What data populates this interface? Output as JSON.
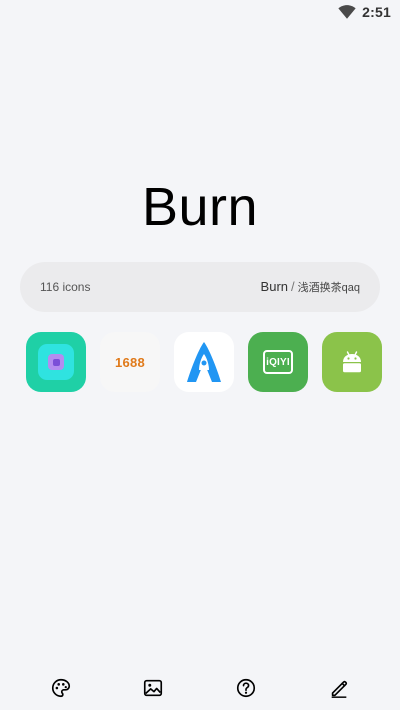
{
  "status_bar": {
    "time": "2:51",
    "wifi_icon": "wifi-icon"
  },
  "app": {
    "title": "Burn"
  },
  "info": {
    "icon_count": "116 icons",
    "author_name": "Burn",
    "separator": "/",
    "author_sub": "浅酒换茶qaq"
  },
  "preview_icons": [
    {
      "name": "teal-app-icon",
      "label": ""
    },
    {
      "name": "1688-app-icon",
      "label": "1688"
    },
    {
      "name": "rocket-app-icon",
      "label": ""
    },
    {
      "name": "iqiyi-app-icon",
      "label": "iQIYI"
    },
    {
      "name": "android-app-icon",
      "label": ""
    }
  ],
  "bottom_nav": [
    {
      "name": "palette-icon"
    },
    {
      "name": "wallpaper-icon"
    },
    {
      "name": "help-icon"
    },
    {
      "name": "edit-icon"
    }
  ],
  "colors": {
    "background": "#f4f5f8",
    "pill": "#ebebed",
    "teal": "#1fd0a6",
    "orange_1688": "#e07a1a",
    "iqiyi_green": "#4caf50",
    "android_green": "#8bc34a",
    "rocket_blue": "#2196f3"
  }
}
